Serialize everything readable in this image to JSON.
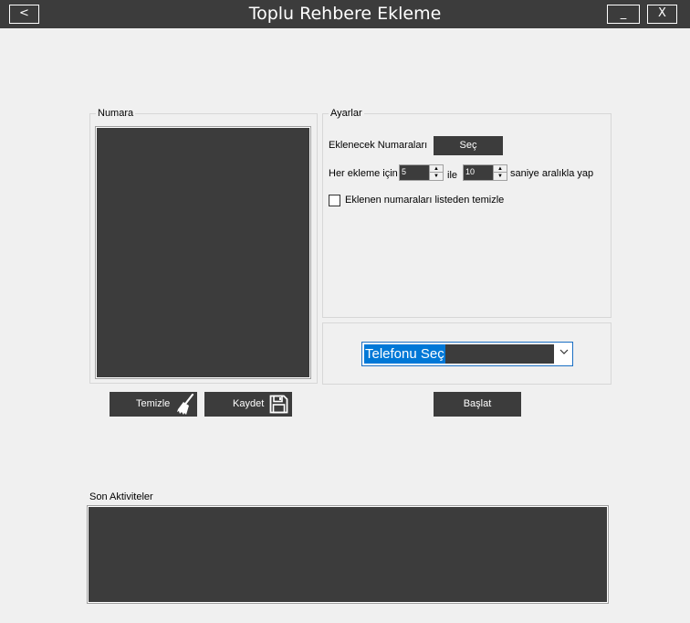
{
  "window": {
    "title": "Toplu Rehbere Ekleme",
    "back_label": "<",
    "minimize_label": "_",
    "close_label": "X"
  },
  "numara_group": {
    "label": "Numara"
  },
  "ayarlar_group": {
    "label": "Ayarlar",
    "eklenecek_label": "Eklenecek Numaraları",
    "sec_button": "Seç",
    "her_ekleme_label": "Her ekleme için",
    "min_value": "5",
    "ile_label": "ile",
    "max_value": "10",
    "saniye_label": "saniye aralıkla yap",
    "checkbox_label": "Eklenen numaraları listeden temizle",
    "checkbox_checked": false
  },
  "phone_select": {
    "selected": "Telefonu Seç"
  },
  "buttons": {
    "temizle": "Temizle",
    "kaydet": "Kaydet",
    "baslat": "Başlat"
  },
  "activities": {
    "label": "Son Aktiviteler"
  },
  "icons": {
    "temizle": "broom-icon",
    "kaydet": "floppy-disk-icon"
  },
  "colors": {
    "dark": "#3c3c3c",
    "background": "#f0f0f0",
    "selection": "#0078d7"
  }
}
